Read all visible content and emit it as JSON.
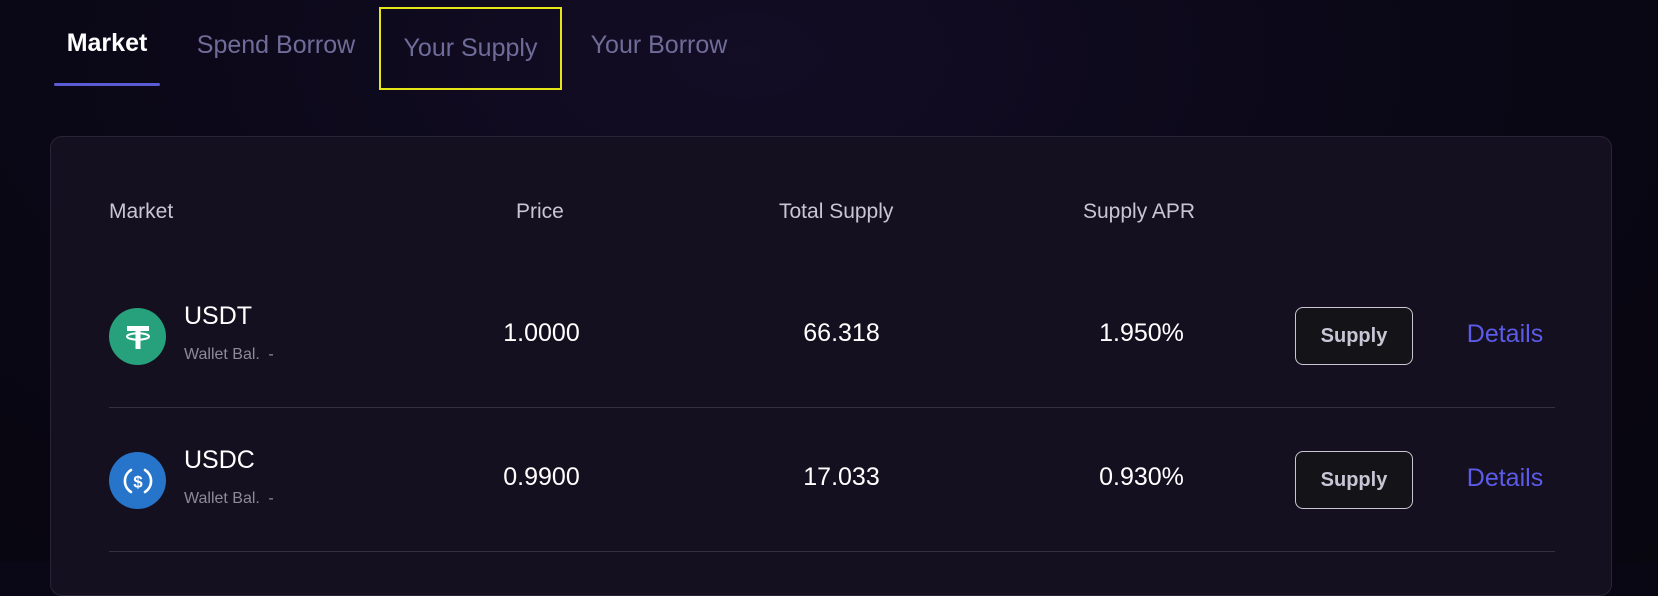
{
  "tabs": [
    {
      "label": "Market",
      "active": true
    },
    {
      "label": "Spend Borrow",
      "active": false
    },
    {
      "label": "Your Supply",
      "active": false,
      "highlighted": true
    },
    {
      "label": "Your Borrow",
      "active": false
    }
  ],
  "table": {
    "headers": {
      "market": "Market",
      "price": "Price",
      "total_supply": "Total Supply",
      "supply_apr": "Supply APR"
    },
    "rows": [
      {
        "token": "USDT",
        "icon": "tether-icon",
        "icon_color": "#26a17b",
        "wallet_label": "Wallet Bal.",
        "wallet_value": "-",
        "price": "1.0000",
        "total_supply": "66.318",
        "supply_apr": "1.950%",
        "action_label": "Supply",
        "details_label": "Details"
      },
      {
        "token": "USDC",
        "icon": "usdc-icon",
        "icon_color": "#2775ca",
        "wallet_label": "Wallet Bal.",
        "wallet_value": "-",
        "price": "0.9900",
        "total_supply": "17.033",
        "supply_apr": "0.930%",
        "action_label": "Supply",
        "details_label": "Details"
      }
    ]
  },
  "colors": {
    "accent": "#5b5bd6",
    "link": "#5b5be8",
    "highlight": "#e6e617",
    "background": "#0a0716"
  }
}
